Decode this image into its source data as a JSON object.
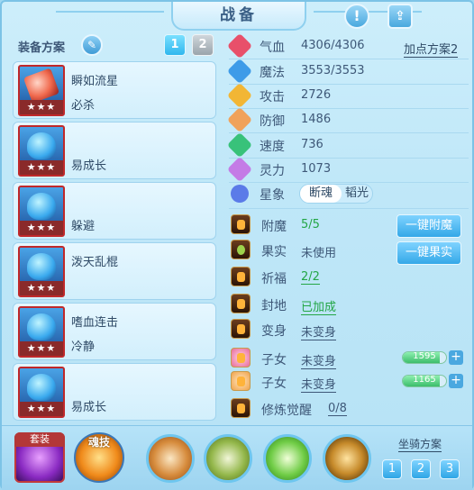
{
  "header": {
    "title": "战备",
    "info_icon": "info-icon",
    "share_icon": "share-icon"
  },
  "left": {
    "plan_label": "装备方案",
    "tabs": [
      "1",
      "2"
    ],
    "skills": [
      {
        "name": "瞬如流星",
        "sub": "必杀",
        "stars": "★★★",
        "style": "red"
      },
      {
        "name": "",
        "sub": "易成长",
        "stars": "★★★",
        "style": "blue"
      },
      {
        "name": "",
        "sub": "躲避",
        "stars": "★★★",
        "style": "blue"
      },
      {
        "name": "泼天乱棍",
        "sub": "",
        "stars": "★★★",
        "style": "blue"
      },
      {
        "name": "嗜血连击",
        "sub": "冷静",
        "stars": "★★★",
        "style": "blue"
      },
      {
        "name": "",
        "sub": "易成长",
        "stars": "★★★",
        "style": "blue"
      }
    ]
  },
  "stats": {
    "addpoint_label": "加点方案2",
    "rows": [
      {
        "label": "气血",
        "value": "4306/4306",
        "color": "#e8506a"
      },
      {
        "label": "魔法",
        "value": "3553/3553",
        "color": "#3e9be8"
      },
      {
        "label": "攻击",
        "value": "2726",
        "color": "#f2b635"
      },
      {
        "label": "防御",
        "value": "1486",
        "color": "#f0a25a"
      },
      {
        "label": "速度",
        "value": "736",
        "color": "#38c27a"
      },
      {
        "label": "灵力",
        "value": "1073",
        "color": "#c47be6"
      }
    ]
  },
  "xingxiang": {
    "label": "星象",
    "option_a": "断魂",
    "option_b": "韬光"
  },
  "rich": [
    {
      "label": "附魔",
      "value": "5/5",
      "style": "green"
    },
    {
      "label": "果实",
      "value": "未使用",
      "style": "plain"
    },
    {
      "label": "祈福",
      "value": "2/2",
      "style": "green"
    },
    {
      "label": "封地",
      "value": "已加成",
      "style": "green"
    },
    {
      "label": "变身",
      "value": "未变身",
      "style": "normal"
    },
    {
      "label": "子女",
      "value": "未变身",
      "style": "normal"
    },
    {
      "label": "子女",
      "value": "未变身",
      "style": "normal"
    },
    {
      "label": "修炼觉醒",
      "value": "0/8",
      "style": "rev"
    }
  ],
  "buttons": {
    "one_key_enchant": "一键附魔",
    "one_key_fruit": "一键果实"
  },
  "bars": [
    {
      "text": "1595",
      "fill": 0.85
    },
    {
      "text": "1165",
      "fill": 0.85
    }
  ],
  "bottom": {
    "set_label": "套装",
    "soul_label": "魂技",
    "mount_label": "坐骑方案",
    "mount_tabs": [
      "1",
      "2",
      "3"
    ]
  }
}
